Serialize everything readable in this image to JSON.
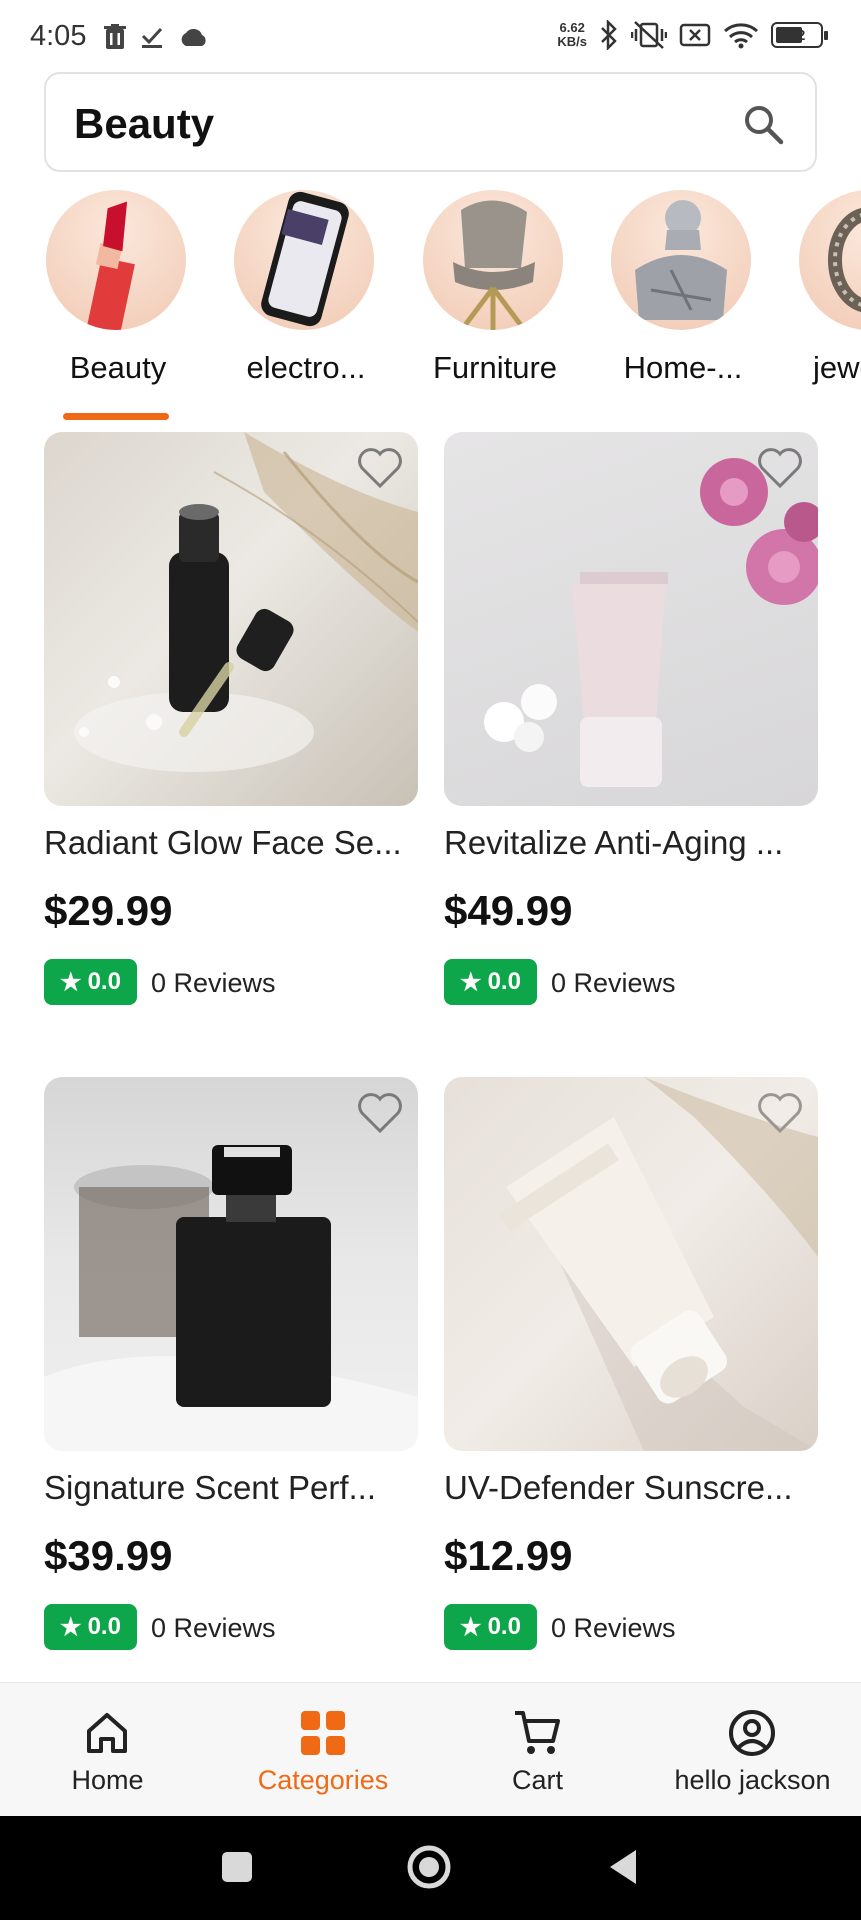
{
  "status_bar": {
    "time": "4:05",
    "net_speed_value": "6.62",
    "net_speed_unit": "KB/s",
    "battery_level": "52",
    "left_icons": [
      "trash-icon",
      "check-icon",
      "cloud-icon"
    ],
    "right_icons": [
      "bluetooth-icon",
      "vibrate-off-icon",
      "no-sim-icon",
      "wifi-icon",
      "battery-icon"
    ]
  },
  "search": {
    "value": "Beauty"
  },
  "categories": {
    "selected_index": 0,
    "accent_color": "#f06a16",
    "items": [
      {
        "label": "Beauty",
        "icon": "lipstick-icon"
      },
      {
        "label": "electro...",
        "icon": "phone-icon"
      },
      {
        "label": "Furniture",
        "icon": "chair-icon"
      },
      {
        "label": "Home-...",
        "icon": "statue-icon"
      },
      {
        "label": "jewe",
        "icon": "ring-icon"
      }
    ]
  },
  "products": [
    {
      "name": "Radiant Glow Face Se...",
      "price": "$29.99",
      "rating": "0.0",
      "reviews": "0 Reviews",
      "image": "serum-bottle-image"
    },
    {
      "name": "Revitalize Anti-Aging ...",
      "price": "$49.99",
      "rating": "0.0",
      "reviews": "0 Reviews",
      "image": "cream-tube-image"
    },
    {
      "name": "Signature Scent Perf...",
      "price": "$39.99",
      "rating": "0.0",
      "reviews": "0 Reviews",
      "image": "perfume-bottle-image"
    },
    {
      "name": "UV-Defender Sunscre...",
      "price": "$12.99",
      "rating": "0.0",
      "reviews": "0 Reviews",
      "image": "sunscreen-tube-image"
    }
  ],
  "rating_color": "#0ea64a",
  "bottom_nav": {
    "active_index": 1,
    "items": [
      {
        "label": "Home",
        "icon": "home-icon"
      },
      {
        "label": "Categories",
        "icon": "grid-icon"
      },
      {
        "label": "Cart",
        "icon": "cart-icon"
      },
      {
        "label": "hello jackson",
        "icon": "user-icon"
      }
    ]
  }
}
